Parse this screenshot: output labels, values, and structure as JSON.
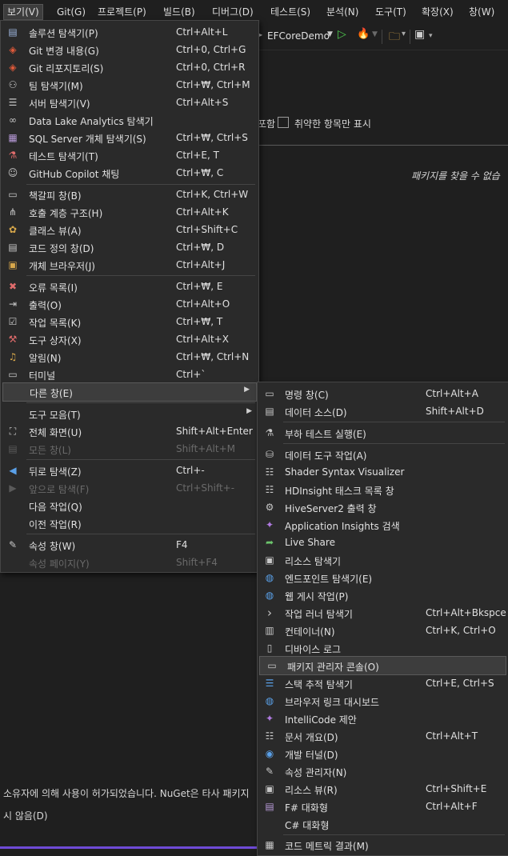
{
  "menubar": {
    "items": [
      "보기(V)",
      "Git(G)",
      "프로젝트(P)",
      "빌드(B)",
      "디버그(D)",
      "테스트(S)",
      "분석(N)",
      "도구(T)",
      "확장(X)",
      "창(W)"
    ]
  },
  "toolbar": {
    "project_name": "EFCoreDemo"
  },
  "background": {
    "include_prefix": "포함",
    "vuln_only_label": "취약한 항목만 표시",
    "not_found": "패키지를 찾을 수 없습",
    "license_text": "소유자에 의해 사용이 허가되었습니다. NuGet은 타사 패키지",
    "dont_show": "시 않음(D)"
  },
  "view_menu": {
    "items": [
      {
        "icon": "solution-explorer-icon",
        "glyph": "▤",
        "label": "솔루션 탐색기(P)",
        "shortcut": "Ctrl+Alt+L"
      },
      {
        "icon": "git-changes-icon",
        "glyph": "◈",
        "label": "Git 변경 내용(G)",
        "shortcut": "Ctrl+0, Ctrl+G"
      },
      {
        "icon": "git-repository-icon",
        "glyph": "◈",
        "label": "Git 리포지토리(S)",
        "shortcut": "Ctrl+0, Ctrl+R"
      },
      {
        "icon": "team-explorer-icon",
        "glyph": "⚇",
        "label": "팀 탐색기(M)",
        "shortcut": "Ctrl+₩, Ctrl+M"
      },
      {
        "icon": "server-explorer-icon",
        "glyph": "☰",
        "label": "서버 탐색기(V)",
        "shortcut": "Ctrl+Alt+S"
      },
      {
        "icon": "data-lake-icon",
        "glyph": "∞",
        "label": "Data Lake Analytics 탐색기",
        "shortcut": ""
      },
      {
        "icon": "sql-server-icon",
        "glyph": "▦",
        "label": "SQL Server 개체 탐색기(S)",
        "shortcut": "Ctrl+₩, Ctrl+S"
      },
      {
        "icon": "test-explorer-icon",
        "glyph": "⚗",
        "label": "테스트 탐색기(T)",
        "shortcut": "Ctrl+E, T"
      },
      {
        "icon": "copilot-icon",
        "glyph": "☺",
        "label": "GitHub Copilot 채팅",
        "shortcut": "Ctrl+₩, C"
      },
      {
        "icon": "bookmark-window-icon",
        "glyph": "▭",
        "label": "책갈피 창(B)",
        "shortcut": "Ctrl+K, Ctrl+W"
      },
      {
        "icon": "call-hierarchy-icon",
        "glyph": "⋔",
        "label": "호출 계층 구조(H)",
        "shortcut": "Ctrl+Alt+K"
      },
      {
        "icon": "class-view-icon",
        "glyph": "✿",
        "label": "클래스 뷰(A)",
        "shortcut": "Ctrl+Shift+C"
      },
      {
        "icon": "code-definition-icon",
        "glyph": "▤",
        "label": "코드 정의 창(D)",
        "shortcut": "Ctrl+₩, D"
      },
      {
        "icon": "object-browser-icon",
        "glyph": "▣",
        "label": "개체 브라우저(J)",
        "shortcut": "Ctrl+Alt+J"
      },
      {
        "icon": "error-list-icon",
        "glyph": "✖",
        "label": "오류 목록(I)",
        "shortcut": "Ctrl+₩, E"
      },
      {
        "icon": "output-icon",
        "glyph": "⇥",
        "label": "출력(O)",
        "shortcut": "Ctrl+Alt+O"
      },
      {
        "icon": "task-list-icon",
        "glyph": "☑",
        "label": "작업 목록(K)",
        "shortcut": "Ctrl+₩, T"
      },
      {
        "icon": "toolbox-icon",
        "glyph": "⚒",
        "label": "도구 상자(X)",
        "shortcut": "Ctrl+Alt+X"
      },
      {
        "icon": "notifications-icon",
        "glyph": "🔔",
        "label": "알림(N)",
        "shortcut": "Ctrl+₩, Ctrl+N"
      },
      {
        "icon": "terminal-icon",
        "glyph": "▭",
        "label": "터미널",
        "shortcut": "Ctrl+`"
      },
      {
        "icon": "",
        "glyph": "",
        "label": "다른 창(E)",
        "shortcut": ""
      },
      {
        "icon": "",
        "glyph": "",
        "label": "도구 모음(T)",
        "shortcut": ""
      },
      {
        "icon": "full-screen-icon",
        "glyph": "⛶",
        "label": "전체 화면(U)",
        "shortcut": "Shift+Alt+Enter"
      },
      {
        "icon": "all-windows-icon",
        "glyph": "▤",
        "label": "모든 창(L)",
        "shortcut": "Shift+Alt+M"
      },
      {
        "icon": "navigate-back-icon",
        "glyph": "◀",
        "label": "뒤로 탐색(Z)",
        "shortcut": "Ctrl+-"
      },
      {
        "icon": "navigate-forward-icon",
        "glyph": "▶",
        "label": "앞으로 탐색(F)",
        "shortcut": "Ctrl+Shift+-"
      },
      {
        "icon": "",
        "glyph": "",
        "label": "다음 작업(Q)",
        "shortcut": ""
      },
      {
        "icon": "",
        "glyph": "",
        "label": "이전 작업(R)",
        "shortcut": ""
      },
      {
        "icon": "properties-icon",
        "glyph": "🔧",
        "label": "속성 창(W)",
        "shortcut": "F4"
      },
      {
        "icon": "",
        "glyph": "",
        "label": "속성 페이지(Y)",
        "shortcut": "Shift+F4"
      }
    ]
  },
  "other_windows_menu": {
    "items": [
      {
        "icon": "command-window-icon",
        "glyph": "▭",
        "label": "명령 창(C)",
        "shortcut": "Ctrl+Alt+A"
      },
      {
        "icon": "data-sources-icon",
        "glyph": "▤",
        "label": "데이터 소스(D)",
        "shortcut": "Shift+Alt+D"
      },
      {
        "icon": "load-test-icon",
        "glyph": "⚗",
        "label": "부하 테스트 실행(E)",
        "shortcut": ""
      },
      {
        "icon": "data-tools-icon",
        "glyph": "⛁",
        "label": "데이터 도구 작업(A)",
        "shortcut": ""
      },
      {
        "icon": "shader-icon",
        "glyph": "☷",
        "label": "Shader Syntax Visualizer",
        "shortcut": ""
      },
      {
        "icon": "hdinsight-icon",
        "glyph": "☷",
        "label": "HDInsight 태스크 목록 창",
        "shortcut": ""
      },
      {
        "icon": "hiveserver-icon",
        "glyph": "⚙",
        "label": "HiveServer2 출력 창",
        "shortcut": ""
      },
      {
        "icon": "app-insights-icon",
        "glyph": "💡",
        "label": "Application Insights 검색",
        "shortcut": ""
      },
      {
        "icon": "live-share-icon",
        "glyph": "➦",
        "label": "Live Share",
        "shortcut": ""
      },
      {
        "icon": "resource-explorer-icon",
        "glyph": "▣",
        "label": "리소스 탐색기",
        "shortcut": ""
      },
      {
        "icon": "endpoint-explorer-icon",
        "glyph": "🌐",
        "label": "엔드포인트 탐색기(E)",
        "shortcut": ""
      },
      {
        "icon": "web-publish-icon",
        "glyph": "🌐",
        "label": "웹 게시 작업(P)",
        "shortcut": ""
      },
      {
        "icon": "task-runner-icon",
        "glyph": "›",
        "label": "작업 러너 탐색기",
        "shortcut": "Ctrl+Alt+Bkspce"
      },
      {
        "icon": "containers-icon",
        "glyph": "▥",
        "label": "컨테이너(N)",
        "shortcut": "Ctrl+K, Ctrl+O"
      },
      {
        "icon": "device-log-icon",
        "glyph": "▯",
        "label": "디바이스 로그",
        "shortcut": ""
      },
      {
        "icon": "package-manager-console-icon",
        "glyph": "▭",
        "label": "패키지 관리자 콘솔(O)",
        "shortcut": ""
      },
      {
        "icon": "stack-trace-icon",
        "glyph": "☰",
        "label": "스택 추적 탐색기",
        "shortcut": "Ctrl+E, Ctrl+S"
      },
      {
        "icon": "browser-link-icon",
        "glyph": "🌐",
        "label": "브라우저 링크 대시보드",
        "shortcut": ""
      },
      {
        "icon": "intellicode-icon",
        "glyph": "💡",
        "label": "IntelliCode 제안",
        "shortcut": ""
      },
      {
        "icon": "document-outline-icon",
        "glyph": "☷",
        "label": "문서 개요(D)",
        "shortcut": "Ctrl+Alt+T"
      },
      {
        "icon": "dev-tunnels-icon",
        "glyph": "◉",
        "label": "개발 터널(D)",
        "shortcut": ""
      },
      {
        "icon": "property-manager-icon",
        "glyph": "🔧",
        "label": "속성 관리자(N)",
        "shortcut": ""
      },
      {
        "icon": "resource-view-icon",
        "glyph": "▣",
        "label": "리소스 뷰(R)",
        "shortcut": "Ctrl+Shift+E"
      },
      {
        "icon": "fsharp-interactive-icon",
        "glyph": "▤",
        "label": "F# 대화형",
        "shortcut": "Ctrl+Alt+F"
      },
      {
        "icon": "",
        "glyph": "",
        "label": "C# 대화형",
        "shortcut": ""
      },
      {
        "icon": "code-metrics-icon",
        "glyph": "▦",
        "label": "코드 메트릭 결과(M)",
        "shortcut": ""
      }
    ]
  }
}
